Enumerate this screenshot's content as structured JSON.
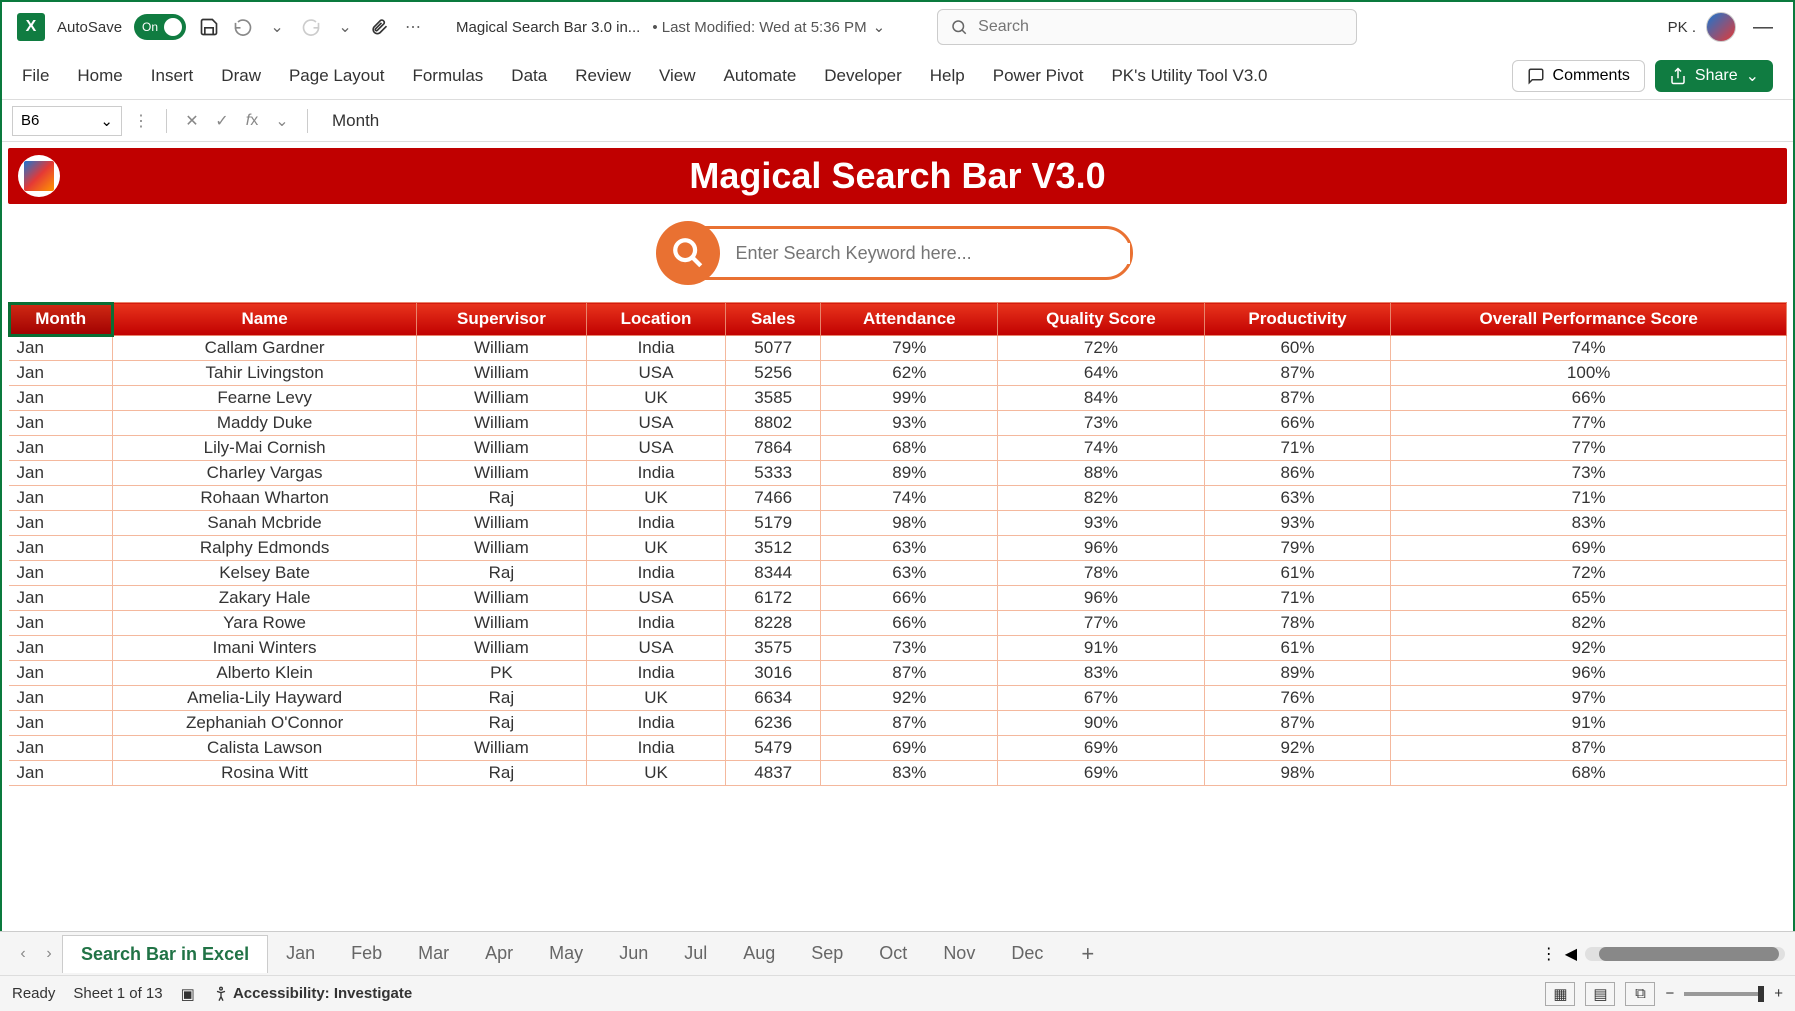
{
  "titlebar": {
    "autosave_label": "AutoSave",
    "autosave_state": "On",
    "file_title": "Magical Search Bar 3.0 in...",
    "last_modified": "• Last Modified: Wed at 5:36 PM",
    "search_placeholder": "Search",
    "user_name": "PK ."
  },
  "ribbon": {
    "tabs": [
      "File",
      "Home",
      "Insert",
      "Draw",
      "Page Layout",
      "Formulas",
      "Data",
      "Review",
      "View",
      "Automate",
      "Developer",
      "Help",
      "Power Pivot",
      "PK's Utility Tool V3.0"
    ],
    "comments_label": "Comments",
    "share_label": "Share"
  },
  "formulabar": {
    "name_box": "B6",
    "formula_value": "Month"
  },
  "banner": {
    "title": "Magical Search Bar V3.0"
  },
  "search_widget": {
    "placeholder": "Enter Search Keyword here..."
  },
  "table": {
    "headers": [
      "Month",
      "Name",
      "Supervisor",
      "Location",
      "Sales",
      "Attendance",
      "Quality Score",
      "Productivity",
      "Overall Performance Score"
    ],
    "rows": [
      [
        "Jan",
        "Callam Gardner",
        "William",
        "India",
        "5077",
        "79%",
        "72%",
        "60%",
        "74%"
      ],
      [
        "Jan",
        "Tahir Livingston",
        "William",
        "USA",
        "5256",
        "62%",
        "64%",
        "87%",
        "100%"
      ],
      [
        "Jan",
        "Fearne Levy",
        "William",
        "UK",
        "3585",
        "99%",
        "84%",
        "87%",
        "66%"
      ],
      [
        "Jan",
        "Maddy Duke",
        "William",
        "USA",
        "8802",
        "93%",
        "73%",
        "66%",
        "77%"
      ],
      [
        "Jan",
        "Lily-Mai Cornish",
        "William",
        "USA",
        "7864",
        "68%",
        "74%",
        "71%",
        "77%"
      ],
      [
        "Jan",
        "Charley Vargas",
        "William",
        "India",
        "5333",
        "89%",
        "88%",
        "86%",
        "73%"
      ],
      [
        "Jan",
        "Rohaan Wharton",
        "Raj",
        "UK",
        "7466",
        "74%",
        "82%",
        "63%",
        "71%"
      ],
      [
        "Jan",
        "Sanah Mcbride",
        "William",
        "India",
        "5179",
        "98%",
        "93%",
        "93%",
        "83%"
      ],
      [
        "Jan",
        "Ralphy Edmonds",
        "William",
        "UK",
        "3512",
        "63%",
        "96%",
        "79%",
        "69%"
      ],
      [
        "Jan",
        "Kelsey Bate",
        "Raj",
        "India",
        "8344",
        "63%",
        "78%",
        "61%",
        "72%"
      ],
      [
        "Jan",
        "Zakary Hale",
        "William",
        "USA",
        "6172",
        "66%",
        "96%",
        "71%",
        "65%"
      ],
      [
        "Jan",
        "Yara Rowe",
        "William",
        "India",
        "8228",
        "66%",
        "77%",
        "78%",
        "82%"
      ],
      [
        "Jan",
        "Imani Winters",
        "William",
        "USA",
        "3575",
        "73%",
        "91%",
        "61%",
        "92%"
      ],
      [
        "Jan",
        "Alberto Klein",
        "PK",
        "India",
        "3016",
        "87%",
        "83%",
        "89%",
        "96%"
      ],
      [
        "Jan",
        "Amelia-Lily Hayward",
        "Raj",
        "UK",
        "6634",
        "92%",
        "67%",
        "76%",
        "97%"
      ],
      [
        "Jan",
        "Zephaniah O'Connor",
        "Raj",
        "India",
        "6236",
        "87%",
        "90%",
        "87%",
        "91%"
      ],
      [
        "Jan",
        "Calista Lawson",
        "William",
        "India",
        "5479",
        "69%",
        "69%",
        "92%",
        "87%"
      ],
      [
        "Jan",
        "Rosina Witt",
        "Raj",
        "UK",
        "4837",
        "83%",
        "69%",
        "98%",
        "68%"
      ]
    ]
  },
  "sheettabs": {
    "active": "Search Bar in Excel",
    "tabs": [
      "Jan",
      "Feb",
      "Mar",
      "Apr",
      "May",
      "Jun",
      "Jul",
      "Aug",
      "Sep",
      "Oct",
      "Nov",
      "Dec"
    ]
  },
  "statusbar": {
    "ready": "Ready",
    "sheet_count": "Sheet 1 of 13",
    "accessibility": "Accessibility: Investigate"
  }
}
